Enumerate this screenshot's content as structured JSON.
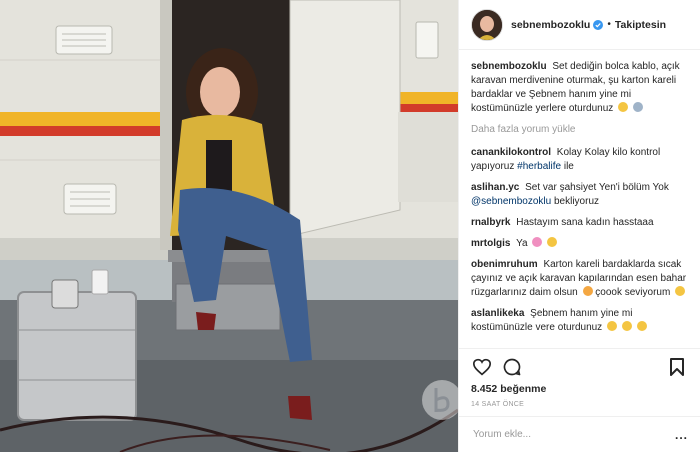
{
  "post": {
    "author": {
      "username": "sebnembozoklu",
      "verified": true,
      "avatar_icon": "profile-avatar"
    },
    "follow_status": "Takiptesin",
    "separator": "•",
    "caption": "Set dediğin bolca kablo, açık karavan merdivenine oturmak, şu karton kareli bardaklar ve Şebnem hanım yine mi kostümünüzle yerlere oturdunuz",
    "load_more": "Daha fazla yorum yükle",
    "comments": [
      {
        "user": "canankilokontrol",
        "text": "Kolay Kolay kilo kontrol yapıyoruz",
        "hashtag": "#herbalife",
        "text_after": "ile"
      },
      {
        "user": "aslihan.yc",
        "text": "Set var şahsiyet Yen'i bölüm Yok",
        "mention": "@sebnembozoklu",
        "text_after": "bekliyoruz"
      },
      {
        "user": "rnalbyrk",
        "text": "Hastayım sana kadın hasstaaa"
      },
      {
        "user": "mrtolgis",
        "text": "Ya"
      },
      {
        "user": "obenimruhum",
        "text": "Karton kareli bardaklarda sıcak çayınız ve açık karavan kapılarından esen bahar rüzgarlarınız daim olsun",
        "text_after": "çoook seviyorum"
      },
      {
        "user": "aslanlikeka",
        "text": "Şebnem hanım yine mi kostümünüzle vere oturdunuz"
      }
    ],
    "likes": "8.452 beğenme",
    "timestamp": "14 SAAT ÖNCE",
    "comment_placeholder": "Yorum ekle...",
    "more_options": "...",
    "icons": {
      "like": "heart-icon",
      "comment": "comment-bubble-icon",
      "save": "bookmark-icon"
    },
    "colors": {
      "link": "#003569",
      "muted": "#999999",
      "verified": "#3897f0",
      "text": "#262626"
    }
  }
}
